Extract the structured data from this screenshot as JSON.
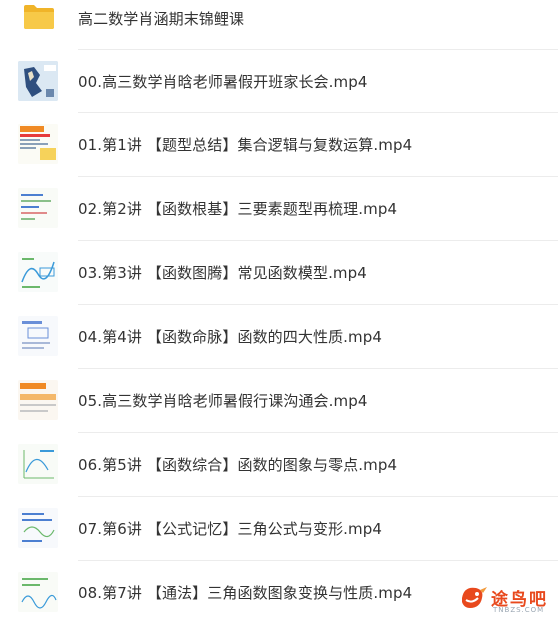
{
  "folder": {
    "name": "高二数学肖涵期末锦鲤课",
    "icon": "folder-icon"
  },
  "files": [
    {
      "name": "00.高三数学肖晗老师暑假开班家长会.mp4",
      "thumb": "video-thumbnail-map"
    },
    {
      "name": "01.第1讲 【题型总结】集合逻辑与复数运算.mp4",
      "thumb": "video-thumbnail-slide-orange"
    },
    {
      "name": "02.第2讲 【函数根基】三要素题型再梳理.mp4",
      "thumb": "video-thumbnail-whiteboard"
    },
    {
      "name": "03.第3讲 【函数图腾】常见函数模型.mp4",
      "thumb": "video-thumbnail-whiteboard"
    },
    {
      "name": "04.第4讲 【函数命脉】函数的四大性质.mp4",
      "thumb": "video-thumbnail-whiteboard"
    },
    {
      "name": "05.高三数学肖晗老师暑假行课沟通会.mp4",
      "thumb": "video-thumbnail-slide-orange"
    },
    {
      "name": "06.第5讲 【函数综合】函数的图象与零点.mp4",
      "thumb": "video-thumbnail-whiteboard"
    },
    {
      "name": "07.第6讲 【公式记忆】三角公式与变形.mp4",
      "thumb": "video-thumbnail-whiteboard"
    },
    {
      "name": "08.第7讲 【通法】三角函数图象变换与性质.mp4",
      "thumb": "video-thumbnail-whiteboard"
    }
  ],
  "watermark": {
    "text": "途鸟吧",
    "sub": "TNBZS.COM",
    "accent": "#e8491d"
  },
  "colors": {
    "folder": "#f5c242",
    "text": "#333333",
    "separator": "#ececec"
  }
}
